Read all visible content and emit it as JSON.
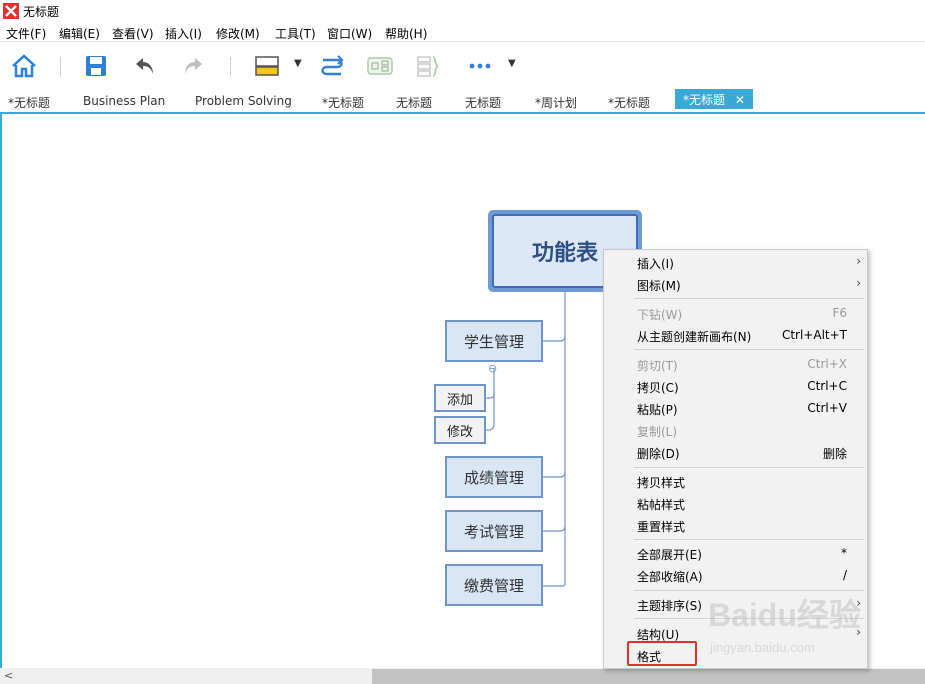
{
  "window": {
    "title": "无标题"
  },
  "menubar": [
    "文件(F)",
    "编辑(E)",
    "查看(V)",
    "插入(I)",
    "修改(M)",
    "工具(T)",
    "窗口(W)",
    "帮助(H)"
  ],
  "toolbar": {
    "icons": [
      "home-icon",
      "save-icon",
      "undo-icon",
      "redo-icon",
      "topic-style-icon",
      "relationship-icon",
      "boundary-icon",
      "summary-icon",
      "more-icon"
    ]
  },
  "tabs": [
    {
      "label": "*无标题"
    },
    {
      "label": "Business Plan"
    },
    {
      "label": "Problem Solving"
    },
    {
      "label": "*无标题"
    },
    {
      "label": "无标题"
    },
    {
      "label": "无标题"
    },
    {
      "label": "*周计划"
    },
    {
      "label": "*无标题"
    },
    {
      "label": "*无标题",
      "active": true,
      "close": "✕"
    }
  ],
  "mindmap": {
    "central": "功能表",
    "topics": [
      "学生管理",
      "成绩管理",
      "考试管理",
      "缴费管理"
    ],
    "subtopics": [
      "添加",
      "修改"
    ],
    "collapse_symbol": "⊖"
  },
  "context_menu": {
    "items": [
      {
        "label": "插入(I)",
        "submenu": true
      },
      {
        "label": "图标(M)",
        "submenu": true
      },
      {
        "label": "下钻(W)",
        "shortcut": "F6",
        "disabled": true
      },
      {
        "label": "从主题创建新画布(N)",
        "shortcut": "Ctrl+Alt+T"
      },
      {
        "label": "剪切(T)",
        "shortcut": "Ctrl+X",
        "disabled": true
      },
      {
        "label": "拷贝(C)",
        "shortcut": "Ctrl+C"
      },
      {
        "label": "粘贴(P)",
        "shortcut": "Ctrl+V"
      },
      {
        "label": "复制(L)",
        "disabled": true
      },
      {
        "label": "删除(D)",
        "shortcut": "删除"
      },
      {
        "label": "拷贝样式"
      },
      {
        "label": "粘帖样式"
      },
      {
        "label": "重置样式"
      },
      {
        "label": "全部展开(E)",
        "shortcut": "*"
      },
      {
        "label": "全部收缩(A)",
        "shortcut": "/"
      },
      {
        "label": "主题排序(S)",
        "submenu": true
      },
      {
        "label": "结构(U)",
        "submenu": true
      },
      {
        "label": "格式"
      }
    ],
    "submenu_arrow": "›"
  },
  "scrollbar": {
    "left_arrow": "<"
  },
  "watermark": {
    "main": "Baidu经验",
    "url": "jingyan.baidu.com"
  },
  "colors": {
    "accent": "#3ba9d6",
    "topic_border": "#6f95c8",
    "highlight": "#e03030"
  }
}
